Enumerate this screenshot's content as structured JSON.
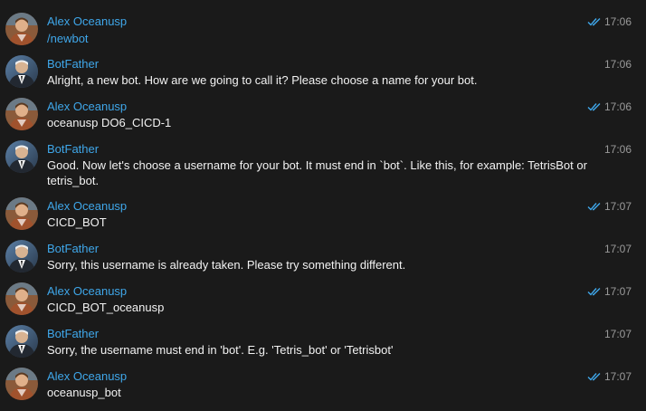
{
  "messages": [
    {
      "sender": "Alex Oceanusp",
      "text": "/newbot",
      "time": "17:06",
      "read": true,
      "type": "user"
    },
    {
      "sender": "BotFather",
      "text": "Alright, a new bot. How are we going to call it? Please choose a name for your bot.",
      "time": "17:06",
      "read": false,
      "type": "bot"
    },
    {
      "sender": "Alex Oceanusp",
      "text": "oceanusp DO6_CICD-1",
      "time": "17:06",
      "read": true,
      "type": "user"
    },
    {
      "sender": "BotFather",
      "text": "Good. Now let's choose a username for your bot. It must end in `bot`. Like this, for example: TetrisBot or tetris_bot.",
      "time": "17:06",
      "read": false,
      "type": "bot"
    },
    {
      "sender": "Alex Oceanusp",
      "text": "CICD_BOT",
      "time": "17:07",
      "read": true,
      "type": "user"
    },
    {
      "sender": "BotFather",
      "text": "Sorry, this username is already taken. Please try something different.",
      "time": "17:07",
      "read": false,
      "type": "bot"
    },
    {
      "sender": "Alex Oceanusp",
      "text": "CICD_BOT_oceanusp",
      "time": "17:07",
      "read": true,
      "type": "user"
    },
    {
      "sender": "BotFather",
      "text": "Sorry, the username must end in 'bot'. E.g. 'Tetris_bot' or 'Tetrisbot'",
      "time": "17:07",
      "read": false,
      "type": "bot"
    },
    {
      "sender": "Alex Oceanusp",
      "text": "oceanusp_bot",
      "time": "17:07",
      "read": true,
      "type": "user"
    }
  ],
  "colors": {
    "background": "#1a1a1a",
    "sender_name": "#3fa7ea",
    "message_text": "#f2f2f2",
    "time_text": "#9a9a9a",
    "read_check": "#3fa7ea"
  },
  "icons": {
    "read_status": "double-check-icon",
    "user_avatar": "user-avatar",
    "bot_avatar": "botfather-avatar"
  }
}
